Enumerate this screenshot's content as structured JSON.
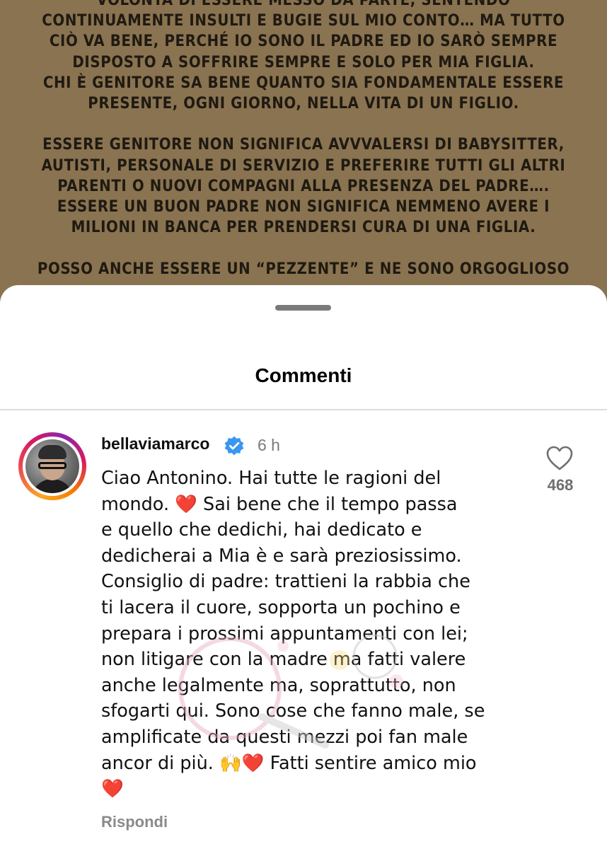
{
  "post": {
    "text": "VOLONTÀ DI ESSERE MESSO DA PARTE, SENTENDO\nCONTINUAMENTE INSULTI E BUGIE SUL MIO CONTO… MA TUTTO\nCIÒ VA BENE, PERCHÉ IO SONO IL PADRE ED IO SARÒ SEMPRE\nDISPOSTO A SOFFRIRE SEMPRE E SOLO PER MIA FIGLIA.\nCHI È GENITORE SA BENE QUANTO SIA FONDAMENTALE ESSERE\nPRESENTE, OGNI GIORNO, NELLA VITA DI UN FIGLIO.\n\nESSERE GENITORE NON SIGNIFICA AVVVALERSI DI BABYSITTER,\nAUTISTI, PERSONALE DI SERVIZIO E PREFERIRE TUTTI GLI ALTRI\nPARENTI O NUOVI COMPAGNI ALLA PRESENZA DEL PADRE….\nESSERE UN BUON PADRE NON SIGNIFICA NEMMENO AVERE I\nMILIONI IN BANCA PER PRENDERSI CURA DI UNA FIGLIA.\n\nPOSSO ANCHE ESSERE UN “PEZZENTE” E NE SONO ORGOGLIOSO"
  },
  "sheet": {
    "title": "Commenti"
  },
  "comment": {
    "username": "bellaviamarco",
    "time": "6 h",
    "text": "Ciao Antonino. Hai tutte le ragioni del\nmondo. ❤️ Sai bene che il tempo passa\ne quello che dedichi, hai dedicato e\ndedicherai a Mia è e sarà preziosissimo.\nConsiglio di padre: trattieni la rabbia che\nti lacera il cuore, sopporta un pochino e\nprepara i prossimi appuntamenti con lei;\nnon litigare con la madre ma fatti valere\nanche legalmente ma, soprattutto, non\nsfogarti qui. Sono cose che fanno male, se\namplificate da questi mezzi poi fan male\nancor di più. 🙌❤️ Fatti sentire amico mio\n❤️",
    "reply_label": "Rispondi",
    "likes": "468"
  },
  "icons": {
    "verified": "verified-badge-icon",
    "like": "heart-outline-icon"
  },
  "colors": {
    "post_background": "#8a7350",
    "verified": "#3897f0",
    "muted": "#7a7a7a"
  }
}
